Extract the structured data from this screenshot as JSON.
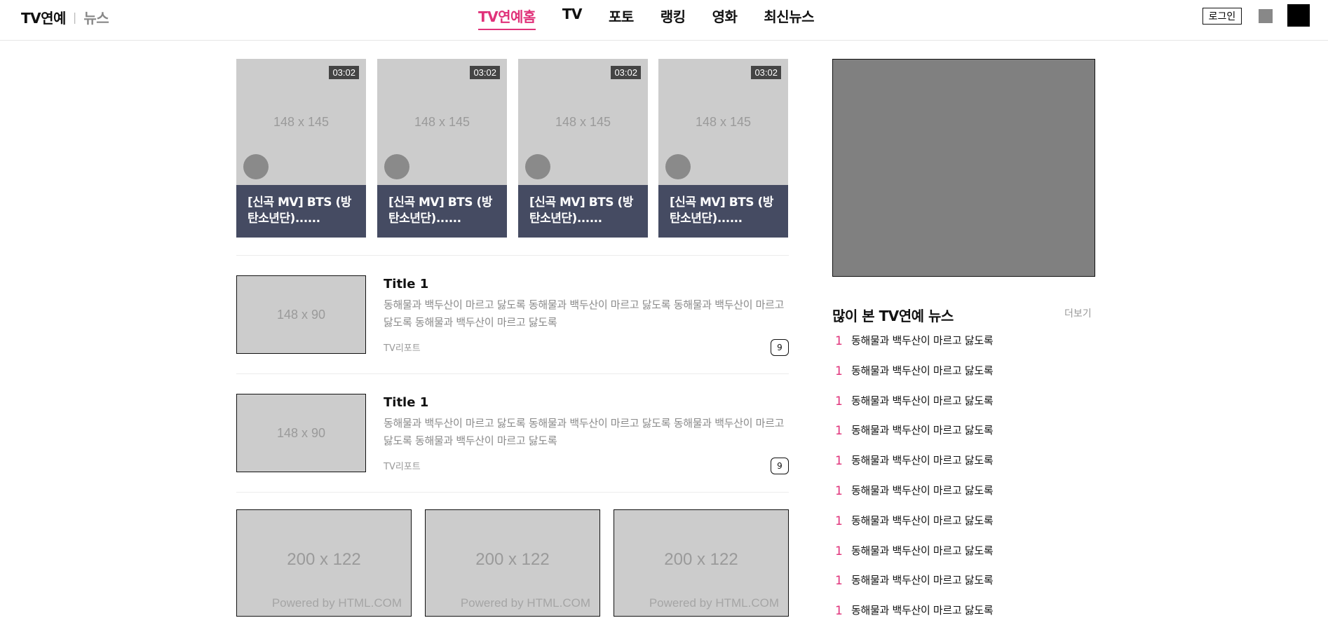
{
  "header": {
    "brand_main": "TV연예",
    "brand_sep": "|",
    "brand_sub": "뉴스",
    "nav": [
      "TV연예홈",
      "TV",
      "포토",
      "랭킹",
      "영화",
      "최신뉴스"
    ],
    "login_label": "로그인"
  },
  "videos": [
    {
      "placeholder": "148 x 145",
      "duration": "03:02",
      "caption": "[신곡 MV] BTS (방탄소년단)......"
    },
    {
      "placeholder": "148 x 145",
      "duration": "03:02",
      "caption": "[신곡 MV] BTS (방탄소년단)......"
    },
    {
      "placeholder": "148 x 145",
      "duration": "03:02",
      "caption": "[신곡 MV] BTS (방탄소년단)......"
    },
    {
      "placeholder": "148 x 145",
      "duration": "03:02",
      "caption": "[신곡 MV] BTS (방탄소년단)......"
    }
  ],
  "news": [
    {
      "placeholder": "148 x 90",
      "title": "Title 1",
      "desc": "동해물과 백두산이 마르고 닳도록 동해물과 백두산이 마르고 닳도록 동해물과 백두산이 마르고 닳도록 동해물과 백두산이 마르고 닳도록",
      "source": "TV리포트",
      "comments": "9"
    },
    {
      "placeholder": "148 x 90",
      "title": "Title 1",
      "desc": "동해물과 백두산이 마르고 닳도록 동해물과 백두산이 마르고 닳도록 동해물과 백두산이 마르고 닳도록 동해물과 백두산이 마르고 닳도록",
      "source": "TV리포트",
      "comments": "9"
    }
  ],
  "photos": [
    {
      "placeholder": "200 x 122",
      "powered": "Powered by HTML.COM"
    },
    {
      "placeholder": "200 x 122",
      "powered": "Powered by HTML.COM"
    },
    {
      "placeholder": "200 x 122",
      "powered": "Powered by HTML.COM"
    }
  ],
  "sidebar": {
    "ranking_title": "많이 본 TV연예 뉴스",
    "more_label": "더보기",
    "ranking": [
      {
        "num": "1",
        "text": "동해물과 백두산이 마르고 닳도록"
      },
      {
        "num": "1",
        "text": "동해물과 백두산이 마르고 닳도록"
      },
      {
        "num": "1",
        "text": "동해물과 백두산이 마르고 닳도록"
      },
      {
        "num": "1",
        "text": "동해물과 백두산이 마르고 닳도록"
      },
      {
        "num": "1",
        "text": "동해물과 백두산이 마르고 닳도록"
      },
      {
        "num": "1",
        "text": "동해물과 백두산이 마르고 닳도록"
      },
      {
        "num": "1",
        "text": "동해물과 백두산이 마르고 닳도록"
      },
      {
        "num": "1",
        "text": "동해물과 백두산이 마르고 닳도록"
      },
      {
        "num": "1",
        "text": "동해물과 백두산이 마르고 닳도록"
      },
      {
        "num": "1",
        "text": "동해물과 백두산이 마르고 닳도록"
      }
    ]
  },
  "colors": {
    "accent": "#e0327a",
    "caption_bg": "#454b62",
    "placeholder_bg": "#cccccc"
  }
}
